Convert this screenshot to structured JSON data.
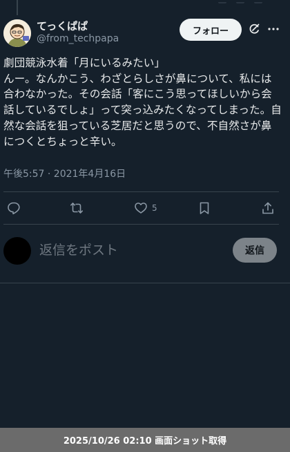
{
  "author": {
    "display_name": "てっくぱぱ",
    "handle": "@from_techpapa"
  },
  "header": {
    "follow_label": "フォロー",
    "grok_icon": "grok-refresh-icon",
    "more_icon": "more-dots-icon"
  },
  "post": {
    "text": "劇団競泳水着「月にいるみたい」\nんー。なんかこう、わざとらしさが鼻について、私には合わなかった。その会話「客にこう思ってほしいから会話しているでしょ」って突っ込みたくなってしまった。自然な会話を狙っている芝居だと思うので、不自然さが鼻につくとちょっと辛い。",
    "timestamp": "午後5:57 · 2021年4月16日"
  },
  "actions": {
    "reply_icon": "reply-icon",
    "retweet_icon": "retweet-icon",
    "like_icon": "heart-icon",
    "like_count": "5",
    "bookmark_icon": "bookmark-icon",
    "share_icon": "share-icon"
  },
  "reply": {
    "placeholder": "返信をポスト",
    "button_label": "返信"
  },
  "screenshot_caption": "2025/10/26 02:10 画面ショット取得",
  "colors": {
    "background": "#15202b",
    "text_primary": "#e7e9ea",
    "text_secondary": "#8b98a5",
    "divider": "#38444d",
    "follow_button_bg": "#eff3f4",
    "reply_button_bg": "#7c8389",
    "caption_bar_bg": "#6b6b6b"
  }
}
